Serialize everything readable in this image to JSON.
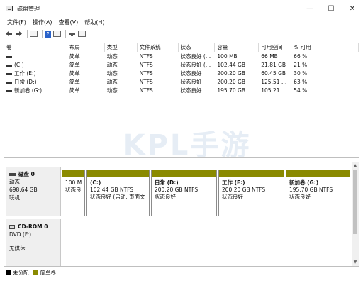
{
  "window": {
    "title": "磁盘管理",
    "minimize_glyph": "—",
    "maximize_glyph": "☐",
    "close_glyph": "✕"
  },
  "menu": [
    "文件(F)",
    "操作(A)",
    "查看(V)",
    "帮助(H)"
  ],
  "toolbar_icons": [
    "back-arrow-icon",
    "forward-arrow-icon",
    "list-view-icon",
    "help-icon",
    "properties-icon",
    "drive-icon",
    "disk-view-icon"
  ],
  "volume_table": {
    "columns": [
      "卷",
      "布局",
      "类型",
      "文件系统",
      "状态",
      "容量",
      "可用空间",
      "% 可用"
    ],
    "rows": [
      {
        "volume": "",
        "layout": "简单",
        "type": "动态",
        "fs": "NTFS",
        "status": "状态良好 (…",
        "capacity": "100 MB",
        "free": "66 MB",
        "pct": "66 %"
      },
      {
        "volume": "(C:)",
        "layout": "简单",
        "type": "动态",
        "fs": "NTFS",
        "status": "状态良好 (…",
        "capacity": "102.44 GB",
        "free": "21.81 GB",
        "pct": "21 %"
      },
      {
        "volume": "工作 (E:)",
        "layout": "简单",
        "type": "动态",
        "fs": "NTFS",
        "status": "状态良好",
        "capacity": "200.20 GB",
        "free": "60.45 GB",
        "pct": "30 %"
      },
      {
        "volume": "日常 (D:)",
        "layout": "简单",
        "type": "动态",
        "fs": "NTFS",
        "status": "状态良好",
        "capacity": "200.20 GB",
        "free": "125.51 …",
        "pct": "63 %"
      },
      {
        "volume": "新加卷 (G:)",
        "layout": "简单",
        "type": "动态",
        "fs": "NTFS",
        "status": "状态良好",
        "capacity": "195.70 GB",
        "free": "105.21 …",
        "pct": "54 %"
      }
    ]
  },
  "watermark": "KPL手游网",
  "disk0": {
    "name": "磁盘 0",
    "type": "动态",
    "size": "698.64 GB",
    "state": "联机",
    "partitions": [
      {
        "name": "",
        "line1": "100 M",
        "line2": "状态良"
      },
      {
        "name": "(C:)",
        "line1": "102.44 GB NTFS",
        "line2": "状态良好 (启动, 页面文"
      },
      {
        "name": "日常  (D:)",
        "line1": "200.20 GB NTFS",
        "line2": "状态良好"
      },
      {
        "name": "工作  (E:)",
        "line1": "200.20 GB NTFS",
        "line2": "状态良好"
      },
      {
        "name": "新加卷  (G:)",
        "line1": "195.70 GB NTFS",
        "line2": "状态良好"
      }
    ]
  },
  "cdrom0": {
    "name": "CD-ROM 0",
    "drive": "DVD (F:)",
    "media": "无媒体"
  },
  "legend": {
    "unallocated": "未分配",
    "simple": "简单卷"
  },
  "colors": {
    "simple_volume": "#8a8a00",
    "unallocated": "#000000"
  }
}
